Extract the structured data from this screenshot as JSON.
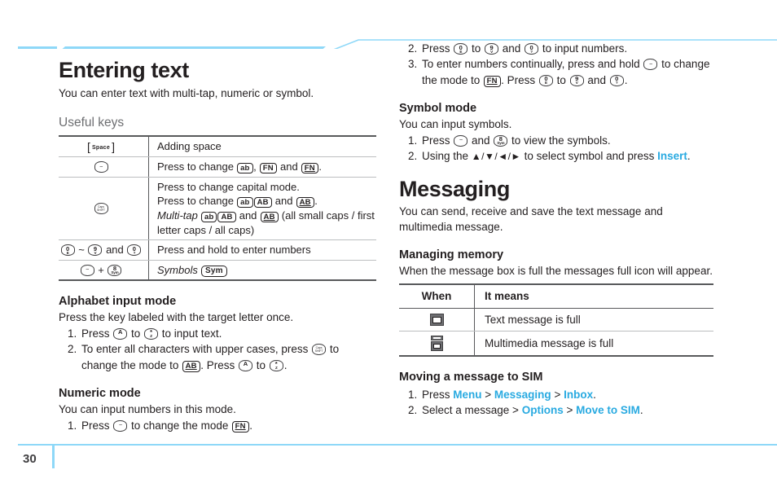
{
  "meta": {
    "page_number": "30",
    "accent_color": "#29aae1",
    "deco_color": "#8ed8f8"
  },
  "left": {
    "chapter_title": "Entering text",
    "chapter_lead": "You can enter text with multi-tap, numeric or symbol.",
    "useful_keys_heading": "Useful keys",
    "useful_keys_table": {
      "rows": [
        {
          "key_icon": "space-key-icon",
          "key_label": "Space",
          "desc_plain": "Adding space"
        },
        {
          "key_icon": "fn-wave-key-icon",
          "desc_prefix": "Press to change ",
          "badge1": "ab",
          "sep1": ", ",
          "badge2": "FN",
          "sep2": " and ",
          "badge3": "FN",
          "suffix": "."
        },
        {
          "key_icon": "caps-shift-key-icon",
          "line1": "Press to change capital mode.",
          "line2_prefix": "Press to change ",
          "line2_badge1": "ab",
          "line2_badge2": "AB",
          "line2_mid": " and ",
          "line2_badge3": "AB",
          "line2_suffix": ".",
          "line3_italic": "Multi-tap",
          "line3_badge1": "ab",
          "line3_badge2": "AB",
          "line3_mid": " and ",
          "line3_badge3": "AB",
          "line3_tail": " (all small caps / first letter caps / all caps)"
        },
        {
          "key_icon": "number-key-range-icon",
          "key_range": "0 ~ 9 and 0",
          "desc_plain": "Press and hold to enter numbers"
        },
        {
          "key_icon": "fn-plus-sym-key-icon",
          "desc_italic": "Symbols",
          "desc_badge": "Sym"
        }
      ]
    },
    "alphabet": {
      "heading": "Alphabet input mode",
      "lead": "Press the key labeled with the target letter once.",
      "step1_a": "Press ",
      "step1_b": " to ",
      "step1_c": " to input text.",
      "step2_a": "To enter all characters with upper cases, press ",
      "step2_b": " to change the mode to ",
      "step2_badge": "AB",
      "step2_c": ". Press ",
      "step2_d": " to ",
      "step2_e": "."
    },
    "numeric": {
      "heading": "Numeric mode",
      "lead": "You can input numbers in this mode.",
      "step1_a": "Press ",
      "step1_b": " to change the mode ",
      "step1_badge": "FN",
      "step1_c": "."
    }
  },
  "right": {
    "numeric_cont": {
      "step2_a": "Press ",
      "step2_b": " to ",
      "step2_c": " and ",
      "step2_d": " to input numbers.",
      "step3_a": "To enter numbers continually, press and hold ",
      "step3_b": " to change the mode to ",
      "step3_badge": "FN",
      "step3_c": ". Press ",
      "step3_d": " to ",
      "step3_e": " and ",
      "step3_f": "."
    },
    "symbol": {
      "heading": "Symbol mode",
      "lead": "You can input symbols.",
      "step1_a": "Press ",
      "step1_b": " and ",
      "step1_c": " to view the symbols.",
      "step2_a": "Using the ",
      "step2_arrows": "▲/▼/◄/►",
      "step2_b": " to select symbol and press ",
      "step2_link": "Insert",
      "step2_c": "."
    },
    "messaging": {
      "chapter_title": "Messaging",
      "chapter_lead": "You can send, receive and save the text message and multimedia message."
    },
    "managing_memory": {
      "heading": "Managing memory",
      "lead": "When the message box is full the messages full icon will appear.",
      "table": {
        "headers": [
          "When",
          "It means"
        ],
        "rows": [
          {
            "icon": "text-message-full-icon",
            "meaning": "Text message is full"
          },
          {
            "icon": "multimedia-message-full-icon",
            "meaning": "Multimedia message is full"
          }
        ]
      }
    },
    "move_sim": {
      "heading": "Moving a message to SIM",
      "step1_a": "Press ",
      "step1_link1": "Menu",
      "step1_sep1": " > ",
      "step1_link2": "Messaging",
      "step1_sep2": " > ",
      "step1_link3": "Inbox",
      "step1_end": ".",
      "step2_a": "Select a message > ",
      "step2_link1": "Options",
      "step2_sep1": " > ",
      "step2_link2": "Move to SIM",
      "step2_end": "."
    }
  },
  "keys": {
    "fn_wave": {
      "main": "~",
      "sub": ""
    },
    "caps": {
      "main": "",
      "sub": "Caps\nSHIFT"
    },
    "num0": {
      "main": "0",
      "sub": "E"
    },
    "num9": {
      "main": "9",
      "sub": "V"
    },
    "num0b": {
      "main": "0",
      "sub": "?"
    },
    "key_a": {
      "main": "A",
      "sub": ""
    },
    "key_z": {
      "main": "*",
      "sub": "Z"
    },
    "key_sym": {
      "main": "8",
      "sub": "Sym"
    }
  }
}
